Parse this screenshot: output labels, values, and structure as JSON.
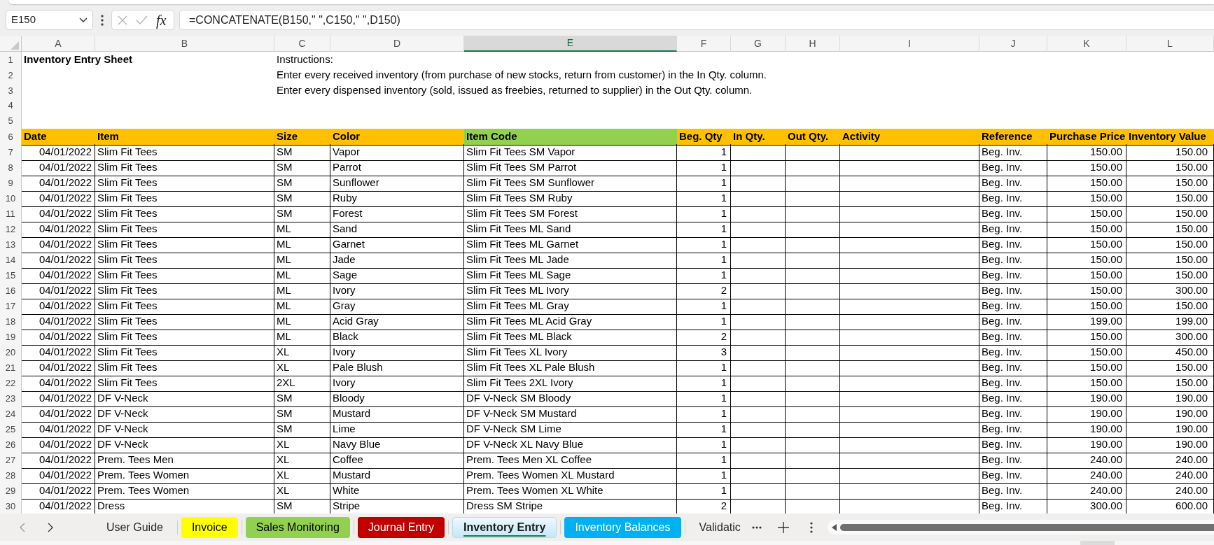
{
  "formula_bar": {
    "name_box": "E150",
    "function_label": "fx",
    "formula": "=CONCATENATE(B150,\" \",C150,\" \",D150)"
  },
  "column_headers": [
    {
      "label": "A",
      "selected": false
    },
    {
      "label": "B",
      "selected": false
    },
    {
      "label": "C",
      "selected": false
    },
    {
      "label": "D",
      "selected": false
    },
    {
      "label": "E",
      "selected": true
    },
    {
      "label": "F",
      "selected": false
    },
    {
      "label": "G",
      "selected": false
    },
    {
      "label": "H",
      "selected": false
    },
    {
      "label": "I",
      "selected": false
    },
    {
      "label": "J",
      "selected": false
    },
    {
      "label": "K",
      "selected": false
    },
    {
      "label": "L",
      "selected": false
    }
  ],
  "rows": [
    {
      "number": "1",
      "kind": "title",
      "cells": {
        "A": "Inventory Entry Sheet",
        "C": "Instructions:"
      }
    },
    {
      "number": "2",
      "kind": "text",
      "cells": {
        "C": "Enter every received inventory (from purchase of new stocks, return from customer) in the In Qty. column."
      }
    },
    {
      "number": "3",
      "kind": "text",
      "cells": {
        "C": "Enter every dispensed inventory (sold, issued as freebies, returned to supplier) in the Out Qty. column."
      }
    },
    {
      "number": "4",
      "kind": "text"
    },
    {
      "number": "5",
      "kind": "text"
    },
    {
      "number": "6",
      "kind": "header",
      "cells": {
        "A": {
          "text": "Date",
          "color": "#ffc000"
        },
        "B": {
          "text": "Item",
          "color": "#ffc000"
        },
        "C": {
          "text": "Size",
          "color": "#ffc000"
        },
        "D": {
          "text": "Color",
          "color": "#ffc000"
        },
        "E": {
          "text": "Item Code",
          "color": "#92d050"
        },
        "F": {
          "text": "Beg. Qty",
          "color": "#ffc000"
        },
        "G": {
          "text": "In Qty.",
          "color": "#ffc000"
        },
        "H": {
          "text": "Out Qty.",
          "color": "#ffc000"
        },
        "I": {
          "text": "Activity",
          "color": "#ffc000"
        },
        "J": {
          "text": "Reference",
          "color": "#ffc000"
        },
        "K": {
          "text": "Purchase Price",
          "color": "#ffc000"
        },
        "L": {
          "text": "Inventory Value",
          "color": "#ffc000"
        }
      }
    },
    {
      "number": "7",
      "kind": "data",
      "cells": {
        "A": "04/01/2022",
        "B": "Slim Fit Tees",
        "C": "SM",
        "D": "Vapor",
        "E": "Slim Fit Tees SM Vapor",
        "F": "1",
        "J": "Beg. Inv.",
        "K": "150.00",
        "L": "150.00"
      }
    },
    {
      "number": "8",
      "kind": "data",
      "cells": {
        "A": "04/01/2022",
        "B": "Slim Fit Tees",
        "C": "SM",
        "D": "Parrot",
        "E": "Slim Fit Tees SM Parrot",
        "F": "1",
        "J": "Beg. Inv.",
        "K": "150.00",
        "L": "150.00"
      }
    },
    {
      "number": "9",
      "kind": "data",
      "cells": {
        "A": "04/01/2022",
        "B": "Slim Fit Tees",
        "C": "SM",
        "D": "Sunflower",
        "E": "Slim Fit Tees SM Sunflower",
        "F": "1",
        "J": "Beg. Inv.",
        "K": "150.00",
        "L": "150.00"
      }
    },
    {
      "number": "10",
      "kind": "data",
      "cells": {
        "A": "04/01/2022",
        "B": "Slim Fit Tees",
        "C": "SM",
        "D": "Ruby",
        "E": "Slim Fit Tees SM Ruby",
        "F": "1",
        "J": "Beg. Inv.",
        "K": "150.00",
        "L": "150.00"
      }
    },
    {
      "number": "11",
      "kind": "data",
      "cells": {
        "A": "04/01/2022",
        "B": "Slim Fit Tees",
        "C": "SM",
        "D": "Forest",
        "E": "Slim Fit Tees SM Forest",
        "F": "1",
        "J": "Beg. Inv.",
        "K": "150.00",
        "L": "150.00"
      }
    },
    {
      "number": "12",
      "kind": "data",
      "cells": {
        "A": "04/01/2022",
        "B": "Slim Fit Tees",
        "C": "ML",
        "D": "Sand",
        "E": "Slim Fit Tees ML Sand",
        "F": "1",
        "J": "Beg. Inv.",
        "K": "150.00",
        "L": "150.00"
      }
    },
    {
      "number": "13",
      "kind": "data",
      "cells": {
        "A": "04/01/2022",
        "B": "Slim Fit Tees",
        "C": "ML",
        "D": "Garnet",
        "E": "Slim Fit Tees ML Garnet",
        "F": "1",
        "J": "Beg. Inv.",
        "K": "150.00",
        "L": "150.00"
      }
    },
    {
      "number": "14",
      "kind": "data",
      "cells": {
        "A": "04/01/2022",
        "B": "Slim Fit Tees",
        "C": "ML",
        "D": "Jade",
        "E": "Slim Fit Tees ML Jade",
        "F": "1",
        "J": "Beg. Inv.",
        "K": "150.00",
        "L": "150.00"
      }
    },
    {
      "number": "15",
      "kind": "data",
      "cells": {
        "A": "04/01/2022",
        "B": "Slim Fit Tees",
        "C": "ML",
        "D": "Sage",
        "E": "Slim Fit Tees ML Sage",
        "F": "1",
        "J": "Beg. Inv.",
        "K": "150.00",
        "L": "150.00"
      }
    },
    {
      "number": "16",
      "kind": "data",
      "cells": {
        "A": "04/01/2022",
        "B": "Slim Fit Tees",
        "C": "ML",
        "D": "Ivory",
        "E": "Slim Fit Tees ML Ivory",
        "F": "2",
        "J": "Beg. Inv.",
        "K": "150.00",
        "L": "300.00"
      }
    },
    {
      "number": "17",
      "kind": "data",
      "cells": {
        "A": "04/01/2022",
        "B": "Slim Fit Tees",
        "C": "ML",
        "D": "Gray",
        "E": "Slim Fit Tees ML Gray",
        "F": "1",
        "J": "Beg. Inv.",
        "K": "150.00",
        "L": "150.00"
      }
    },
    {
      "number": "18",
      "kind": "data",
      "cells": {
        "A": "04/01/2022",
        "B": "Slim Fit Tees",
        "C": "ML",
        "D": "Acid Gray",
        "E": "Slim Fit Tees ML Acid Gray",
        "F": "1",
        "J": "Beg. Inv.",
        "K": "199.00",
        "L": "199.00"
      }
    },
    {
      "number": "19",
      "kind": "data",
      "cells": {
        "A": "04/01/2022",
        "B": "Slim Fit Tees",
        "C": "ML",
        "D": "Black",
        "E": "Slim Fit Tees ML Black",
        "F": "2",
        "J": "Beg. Inv.",
        "K": "150.00",
        "L": "300.00"
      }
    },
    {
      "number": "20",
      "kind": "data",
      "cells": {
        "A": "04/01/2022",
        "B": "Slim Fit Tees",
        "C": "XL",
        "D": "Ivory",
        "E": "Slim Fit Tees XL Ivory",
        "F": "3",
        "J": "Beg. Inv.",
        "K": "150.00",
        "L": "450.00"
      }
    },
    {
      "number": "21",
      "kind": "data",
      "cells": {
        "A": "04/01/2022",
        "B": "Slim Fit Tees",
        "C": "XL",
        "D": "Pale Blush",
        "E": "Slim Fit Tees XL Pale Blush",
        "F": "1",
        "J": "Beg. Inv.",
        "K": "150.00",
        "L": "150.00"
      }
    },
    {
      "number": "22",
      "kind": "data",
      "cells": {
        "A": "04/01/2022",
        "B": "Slim Fit Tees",
        "C": "2XL",
        "D": "Ivory",
        "E": "Slim Fit Tees 2XL Ivory",
        "F": "1",
        "J": "Beg. Inv.",
        "K": "150.00",
        "L": "150.00"
      }
    },
    {
      "number": "23",
      "kind": "data",
      "cells": {
        "A": "04/01/2022",
        "B": "DF V-Neck",
        "C": "SM",
        "D": "Bloody",
        "E": "DF V-Neck SM Bloody",
        "F": "1",
        "J": "Beg. Inv.",
        "K": "190.00",
        "L": "190.00"
      }
    },
    {
      "number": "24",
      "kind": "data",
      "cells": {
        "A": "04/01/2022",
        "B": "DF V-Neck",
        "C": "SM",
        "D": "Mustard",
        "E": "DF V-Neck SM Mustard",
        "F": "1",
        "J": "Beg. Inv.",
        "K": "190.00",
        "L": "190.00"
      }
    },
    {
      "number": "25",
      "kind": "data",
      "cells": {
        "A": "04/01/2022",
        "B": "DF V-Neck",
        "C": "SM",
        "D": "Lime",
        "E": "DF V-Neck SM Lime",
        "F": "1",
        "J": "Beg. Inv.",
        "K": "190.00",
        "L": "190.00"
      }
    },
    {
      "number": "26",
      "kind": "data",
      "cells": {
        "A": "04/01/2022",
        "B": "DF V-Neck",
        "C": "XL",
        "D": "Navy Blue",
        "E": "DF V-Neck XL Navy Blue",
        "F": "1",
        "J": "Beg. Inv.",
        "K": "190.00",
        "L": "190.00"
      }
    },
    {
      "number": "27",
      "kind": "data",
      "cells": {
        "A": "04/01/2022",
        "B": "Prem. Tees Men",
        "C": "XL",
        "D": "Coffee",
        "E": "Prem. Tees Men XL Coffee",
        "F": "1",
        "J": "Beg. Inv.",
        "K": "240.00",
        "L": "240.00"
      }
    },
    {
      "number": "28",
      "kind": "data",
      "cells": {
        "A": "04/01/2022",
        "B": "Prem. Tees Women",
        "C": "XL",
        "D": "Mustard",
        "E": "Prem. Tees Women XL Mustard",
        "F": "1",
        "J": "Beg. Inv.",
        "K": "240.00",
        "L": "240.00"
      }
    },
    {
      "number": "29",
      "kind": "data",
      "cells": {
        "A": "04/01/2022",
        "B": "Prem. Tees Women",
        "C": "XL",
        "D": "White",
        "E": "Prem. Tees Women XL White",
        "F": "1",
        "J": "Beg. Inv.",
        "K": "240.00",
        "L": "240.00"
      }
    },
    {
      "number": "30",
      "kind": "data",
      "cells": {
        "A": "04/01/2022",
        "B": "Dress",
        "C": "SM",
        "D": "Stripe",
        "E": "Dress SM Stripe",
        "F": "2",
        "J": "Beg. Inv.",
        "K": "300.00",
        "L": "600.00"
      }
    }
  ],
  "sheet_tabs": [
    {
      "label": "User Guide",
      "selected": false
    },
    {
      "label": "Invoice",
      "selected": false,
      "color": "#ffff00"
    },
    {
      "label": "Sales Monitoring",
      "selected": false,
      "color": "#92d050"
    },
    {
      "label": "Journal Entry",
      "selected": false,
      "color": "#c00000"
    },
    {
      "label": "Inventory Entry",
      "selected": true
    },
    {
      "label": "Inventory Balances",
      "selected": false,
      "color": "#00b0f0"
    },
    {
      "label": "Validatic",
      "selected": false
    }
  ]
}
